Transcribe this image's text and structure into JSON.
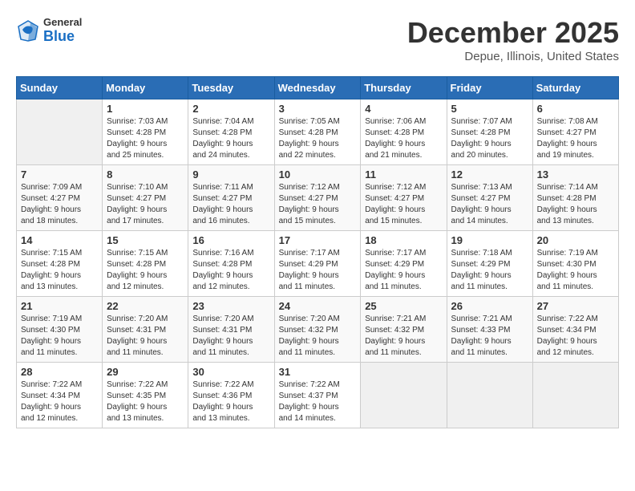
{
  "header": {
    "logo_line1": "General",
    "logo_line2": "Blue",
    "month": "December 2025",
    "location": "Depue, Illinois, United States"
  },
  "days_of_week": [
    "Sunday",
    "Monday",
    "Tuesday",
    "Wednesday",
    "Thursday",
    "Friday",
    "Saturday"
  ],
  "weeks": [
    [
      {
        "day": "",
        "info": ""
      },
      {
        "day": "1",
        "info": "Sunrise: 7:03 AM\nSunset: 4:28 PM\nDaylight: 9 hours\nand 25 minutes."
      },
      {
        "day": "2",
        "info": "Sunrise: 7:04 AM\nSunset: 4:28 PM\nDaylight: 9 hours\nand 24 minutes."
      },
      {
        "day": "3",
        "info": "Sunrise: 7:05 AM\nSunset: 4:28 PM\nDaylight: 9 hours\nand 22 minutes."
      },
      {
        "day": "4",
        "info": "Sunrise: 7:06 AM\nSunset: 4:28 PM\nDaylight: 9 hours\nand 21 minutes."
      },
      {
        "day": "5",
        "info": "Sunrise: 7:07 AM\nSunset: 4:28 PM\nDaylight: 9 hours\nand 20 minutes."
      },
      {
        "day": "6",
        "info": "Sunrise: 7:08 AM\nSunset: 4:27 PM\nDaylight: 9 hours\nand 19 minutes."
      }
    ],
    [
      {
        "day": "7",
        "info": "Sunrise: 7:09 AM\nSunset: 4:27 PM\nDaylight: 9 hours\nand 18 minutes."
      },
      {
        "day": "8",
        "info": "Sunrise: 7:10 AM\nSunset: 4:27 PM\nDaylight: 9 hours\nand 17 minutes."
      },
      {
        "day": "9",
        "info": "Sunrise: 7:11 AM\nSunset: 4:27 PM\nDaylight: 9 hours\nand 16 minutes."
      },
      {
        "day": "10",
        "info": "Sunrise: 7:12 AM\nSunset: 4:27 PM\nDaylight: 9 hours\nand 15 minutes."
      },
      {
        "day": "11",
        "info": "Sunrise: 7:12 AM\nSunset: 4:27 PM\nDaylight: 9 hours\nand 15 minutes."
      },
      {
        "day": "12",
        "info": "Sunrise: 7:13 AM\nSunset: 4:27 PM\nDaylight: 9 hours\nand 14 minutes."
      },
      {
        "day": "13",
        "info": "Sunrise: 7:14 AM\nSunset: 4:28 PM\nDaylight: 9 hours\nand 13 minutes."
      }
    ],
    [
      {
        "day": "14",
        "info": "Sunrise: 7:15 AM\nSunset: 4:28 PM\nDaylight: 9 hours\nand 13 minutes."
      },
      {
        "day": "15",
        "info": "Sunrise: 7:15 AM\nSunset: 4:28 PM\nDaylight: 9 hours\nand 12 minutes."
      },
      {
        "day": "16",
        "info": "Sunrise: 7:16 AM\nSunset: 4:28 PM\nDaylight: 9 hours\nand 12 minutes."
      },
      {
        "day": "17",
        "info": "Sunrise: 7:17 AM\nSunset: 4:29 PM\nDaylight: 9 hours\nand 11 minutes."
      },
      {
        "day": "18",
        "info": "Sunrise: 7:17 AM\nSunset: 4:29 PM\nDaylight: 9 hours\nand 11 minutes."
      },
      {
        "day": "19",
        "info": "Sunrise: 7:18 AM\nSunset: 4:29 PM\nDaylight: 9 hours\nand 11 minutes."
      },
      {
        "day": "20",
        "info": "Sunrise: 7:19 AM\nSunset: 4:30 PM\nDaylight: 9 hours\nand 11 minutes."
      }
    ],
    [
      {
        "day": "21",
        "info": "Sunrise: 7:19 AM\nSunset: 4:30 PM\nDaylight: 9 hours\nand 11 minutes."
      },
      {
        "day": "22",
        "info": "Sunrise: 7:20 AM\nSunset: 4:31 PM\nDaylight: 9 hours\nand 11 minutes."
      },
      {
        "day": "23",
        "info": "Sunrise: 7:20 AM\nSunset: 4:31 PM\nDaylight: 9 hours\nand 11 minutes."
      },
      {
        "day": "24",
        "info": "Sunrise: 7:20 AM\nSunset: 4:32 PM\nDaylight: 9 hours\nand 11 minutes."
      },
      {
        "day": "25",
        "info": "Sunrise: 7:21 AM\nSunset: 4:32 PM\nDaylight: 9 hours\nand 11 minutes."
      },
      {
        "day": "26",
        "info": "Sunrise: 7:21 AM\nSunset: 4:33 PM\nDaylight: 9 hours\nand 11 minutes."
      },
      {
        "day": "27",
        "info": "Sunrise: 7:22 AM\nSunset: 4:34 PM\nDaylight: 9 hours\nand 12 minutes."
      }
    ],
    [
      {
        "day": "28",
        "info": "Sunrise: 7:22 AM\nSunset: 4:34 PM\nDaylight: 9 hours\nand 12 minutes."
      },
      {
        "day": "29",
        "info": "Sunrise: 7:22 AM\nSunset: 4:35 PM\nDaylight: 9 hours\nand 13 minutes."
      },
      {
        "day": "30",
        "info": "Sunrise: 7:22 AM\nSunset: 4:36 PM\nDaylight: 9 hours\nand 13 minutes."
      },
      {
        "day": "31",
        "info": "Sunrise: 7:22 AM\nSunset: 4:37 PM\nDaylight: 9 hours\nand 14 minutes."
      },
      {
        "day": "",
        "info": ""
      },
      {
        "day": "",
        "info": ""
      },
      {
        "day": "",
        "info": ""
      }
    ]
  ]
}
